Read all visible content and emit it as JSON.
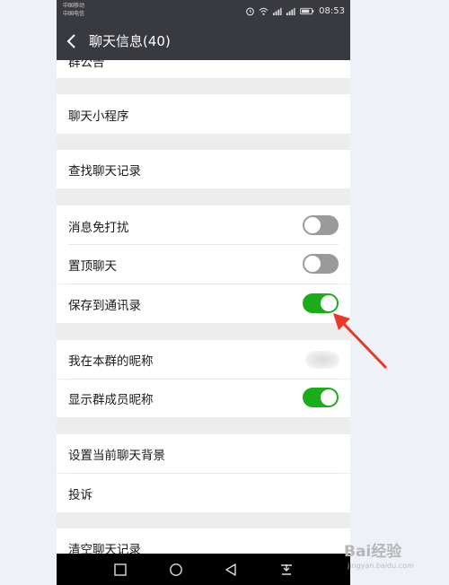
{
  "status_bar": {
    "carrier_1": "中国移动",
    "carrier_2": "中国电信",
    "time": "08:53",
    "icons": [
      "alarm-icon",
      "wifi-icon",
      "signal-icon",
      "signal-icon",
      "battery-icon"
    ]
  },
  "header": {
    "back_icon": "chevron-left-icon",
    "title": "聊天信息(40)"
  },
  "settings": {
    "group_notice": "群公告",
    "mini_programs": "聊天小程序",
    "search_history": "查找聊天记录",
    "mute": {
      "label": "消息免打扰",
      "on": false
    },
    "pin": {
      "label": "置顶聊天",
      "on": false
    },
    "save_to_contacts": {
      "label": "保存到通讯录",
      "on": true
    },
    "my_nickname": {
      "label": "我在本群的昵称"
    },
    "show_nicknames": {
      "label": "显示群成员昵称",
      "on": true
    },
    "set_background": "设置当前聊天背景",
    "report": "投诉",
    "clear_history": "清空聊天记录"
  },
  "nav_bar": {
    "icons": [
      "square-icon",
      "circle-icon",
      "triangle-back-icon",
      "download-icon"
    ]
  },
  "colors": {
    "header_bg": "#393a3f",
    "toggle_on": "#1aad19",
    "toggle_off": "#9a9a9a",
    "arrow": "#e8392b"
  },
  "watermark": {
    "brand": "Bai经验",
    "url": "jingyan.baidu.com"
  }
}
